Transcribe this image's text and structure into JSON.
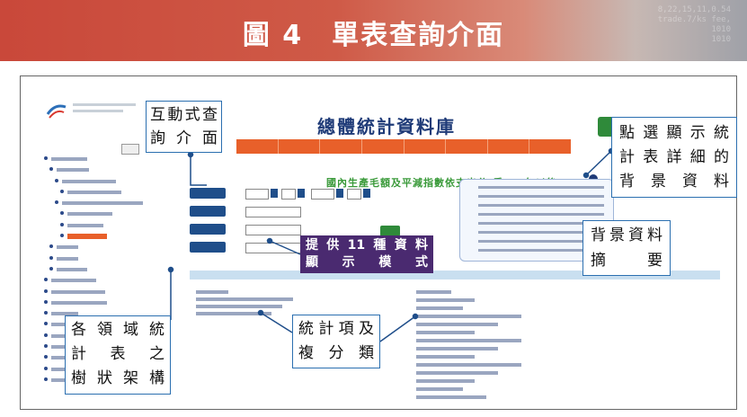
{
  "header": {
    "title": "圖 4　單表查詢介面",
    "deco_lines": [
      "8,22,15,11,0.54",
      "trade.7/ks fee,",
      "1010",
      "1010"
    ]
  },
  "screenshot": {
    "site_title": "總體統計資料庫",
    "table_title": "國內生產毛額及平減指數依支出分-季(70年以後)"
  },
  "callouts": {
    "interactive": [
      "互動式查",
      "詢 介 面"
    ],
    "detail": [
      "點選顯示統",
      "計表詳細的",
      "背 景 資 料"
    ],
    "summary": [
      "背景資料",
      "摘　　要"
    ],
    "tree": [
      "各領域統",
      "計 表 之",
      "樹狀架構"
    ],
    "items": [
      "統計項及",
      "複 分 類"
    ],
    "modes": [
      "提供11種資料",
      "顯 示 模 式"
    ]
  },
  "colors": {
    "header_red": "#c9483a",
    "callout_border": "#2b6fb0",
    "nav_orange": "#e8602a",
    "mode_purple": "#4a2a70",
    "line_blue": "#1f4e8a"
  }
}
